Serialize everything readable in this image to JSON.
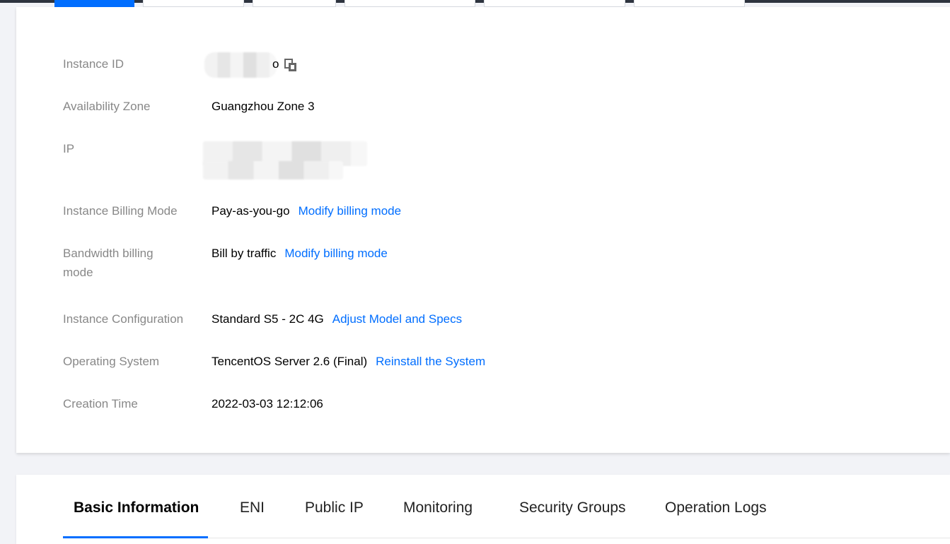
{
  "colors": {
    "accent": "#006eff",
    "label": "#888888",
    "background": "#f2f3f7"
  },
  "details": {
    "instance_id": {
      "label": "Instance ID",
      "value_visible_fragment": "o",
      "icon": "copy-icon"
    },
    "availability_zone": {
      "label": "Availability Zone",
      "value": "Guangzhou Zone 3"
    },
    "ip": {
      "label": "IP"
    },
    "billing_mode": {
      "label": "Instance Billing Mode",
      "value": "Pay-as-you-go",
      "link": "Modify billing mode"
    },
    "bandwidth_billing": {
      "label_line1": "Bandwidth billing",
      "label_line2": "mode",
      "value": "Bill by traffic",
      "link": "Modify billing mode"
    },
    "configuration": {
      "label": "Instance Configuration",
      "value": "Standard S5 - 2C 4G",
      "link": "Adjust Model and Specs"
    },
    "os": {
      "label": "Operating System",
      "value": "TencentOS Server 2.6 (Final)",
      "link": "Reinstall the System"
    },
    "creation_time": {
      "label": "Creation Time",
      "value": "2022-03-03 12:12:06"
    }
  },
  "tabs": [
    {
      "label": "Basic Information",
      "active": true
    },
    {
      "label": "ENI"
    },
    {
      "label": "Public IP"
    },
    {
      "label": "Monitoring"
    },
    {
      "label": "Security Groups"
    },
    {
      "label": "Operation Logs"
    }
  ]
}
